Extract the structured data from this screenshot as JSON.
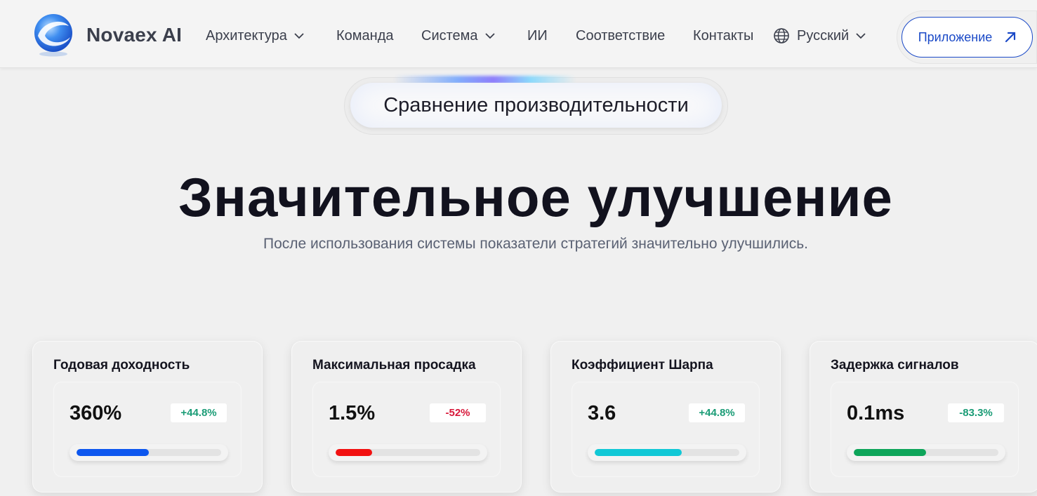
{
  "header": {
    "brand": "Novaex AI",
    "nav": [
      {
        "label": "Архитектура",
        "dropdown": true
      },
      {
        "label": "Команда",
        "dropdown": false
      },
      {
        "label": "Система",
        "dropdown": true
      },
      {
        "label": "ИИ",
        "dropdown": false
      },
      {
        "label": "Соответствие",
        "dropdown": false
      },
      {
        "label": "Контакты",
        "dropdown": false
      }
    ],
    "language": {
      "label": "Русский",
      "icon": "globe-icon"
    },
    "app_button": {
      "label": "Приложение",
      "icon": "arrow-up-right-icon"
    }
  },
  "hero": {
    "pill": "Сравнение производительности",
    "title": "Значительное улучшение",
    "subtitle": "После использования системы показатели стратегий значительно улучшились."
  },
  "metrics": [
    {
      "title": "Годовая доходность",
      "value": "360%",
      "delta": "+44.8%",
      "delta_color": "#1a9c76",
      "progress": 0.5,
      "bar_color": "#0d57ef"
    },
    {
      "title": "Максимальная просадка",
      "value": "1.5%",
      "delta": "-52%",
      "delta_color": "#d8183a",
      "progress": 0.25,
      "bar_color": "#f21111"
    },
    {
      "title": "Коэффициент Шарпа",
      "value": "3.6",
      "delta": "+44.8%",
      "delta_color": "#1a9c76",
      "progress": 0.6,
      "bar_color": "#11c8d6"
    },
    {
      "title": "Задержка сигналов",
      "value": "0.1ms",
      "delta": "-83.3%",
      "delta_color": "#1a9c76",
      "progress": 0.5,
      "bar_color": "#0ea55a"
    }
  ],
  "colors": {
    "accent": "#1a49c7",
    "background": "#f0f0f0"
  }
}
